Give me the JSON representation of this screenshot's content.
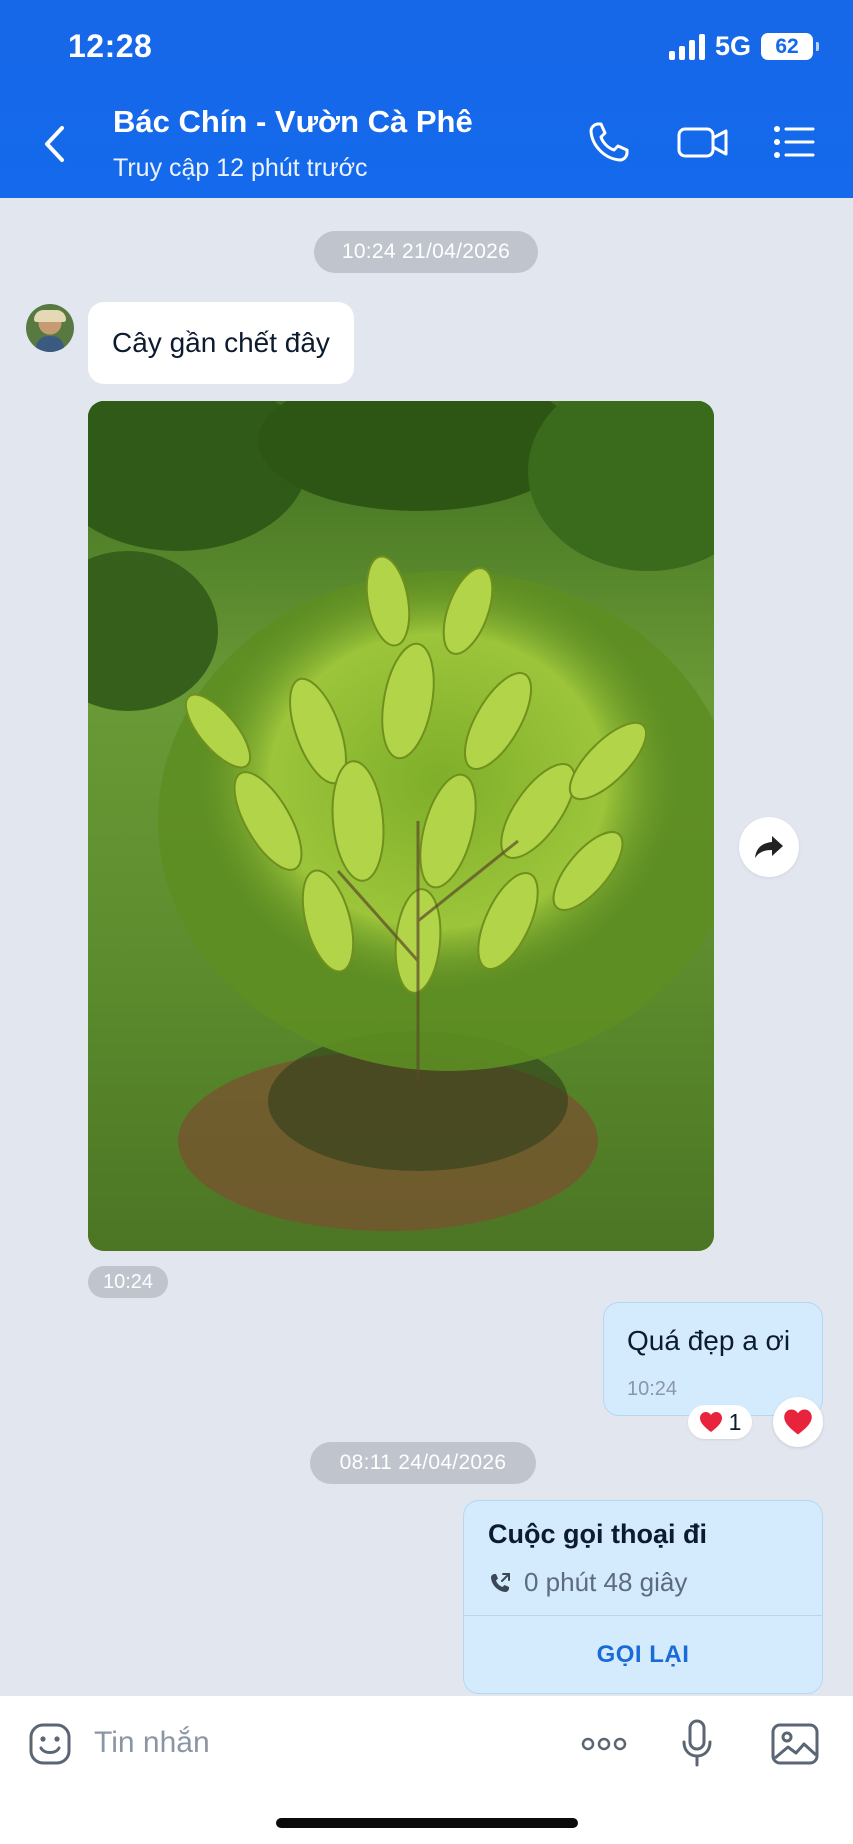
{
  "status_bar": {
    "time": "12:28",
    "network": "5G",
    "battery": "62"
  },
  "header": {
    "title": "Bác Chín - Vườn Cà Phê",
    "subtitle": "Truy cập 12 phút trước",
    "icons": [
      "back-icon",
      "phone-icon",
      "video-icon",
      "menu-icon"
    ]
  },
  "chat": {
    "date_1": "10:24 21/04/2026",
    "incoming_text": "Cây gần chết đây",
    "photo_time": "10:24",
    "outgoing_text": "Quá đẹp a ơi",
    "outgoing_time": "10:24",
    "reaction_count": "1",
    "date_2": "08:11 24/04/2026",
    "call": {
      "title": "Cuộc gọi thoại đi",
      "duration": "0 phút 48 giây",
      "action": "GỌI LẠI"
    }
  },
  "input_bar": {
    "placeholder": "Tin nhắn",
    "icons": [
      "emoji-icon",
      "more-icon",
      "mic-icon",
      "image-icon"
    ]
  },
  "colors": {
    "header_blue": "#1469ec",
    "chat_background": "#e2e6ef",
    "outgoing_bubble": "#d4ebfd",
    "accent_link": "#1a6bd8",
    "heart_red": "#e8243c"
  }
}
